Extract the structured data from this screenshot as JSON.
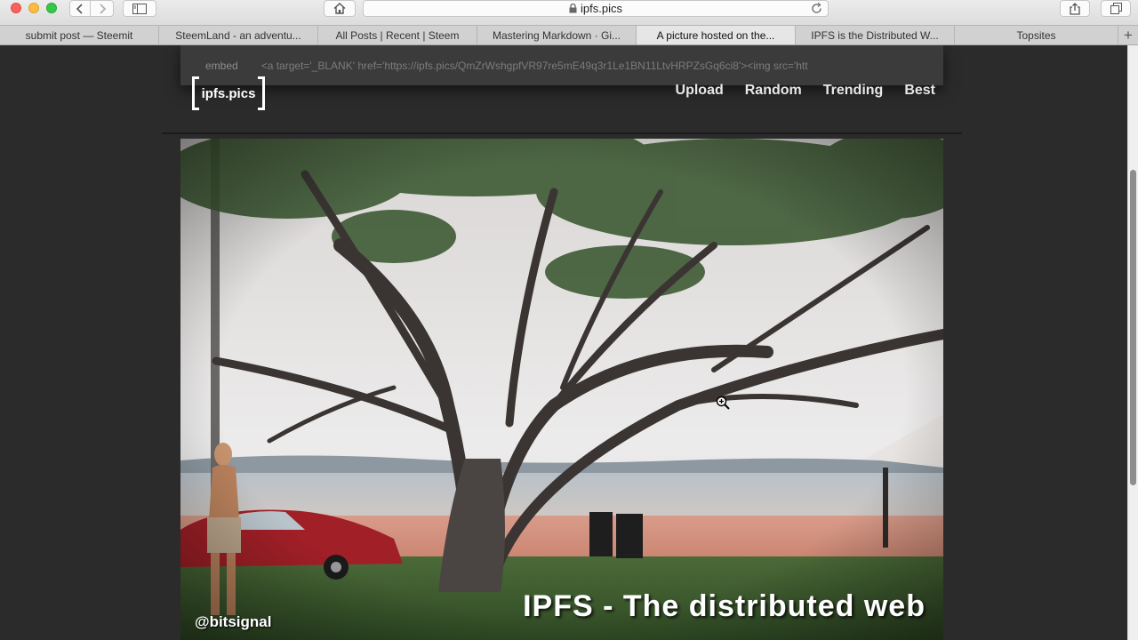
{
  "browser": {
    "url": "ipfs.pics",
    "tabs": [
      {
        "label": "submit post — Steemit"
      },
      {
        "label": "SteemLand - an adventu..."
      },
      {
        "label": "All Posts | Recent | Steem"
      },
      {
        "label": "Mastering Markdown · Gi..."
      },
      {
        "label": "A picture hosted on the..."
      },
      {
        "label": "IPFS is the Distributed W..."
      },
      {
        "label": "Topsites"
      }
    ],
    "active_tab": 4
  },
  "page": {
    "embed_label": "embed",
    "embed_code": "<a target='_BLANK' href='https://ipfs.pics/QmZrWshgpfVR97re5mE49q3r1Le1BN11LtvHRPZsGq6ci8'><img src='htt",
    "logo_text": "ipfs.pics",
    "nav": {
      "upload": "Upload",
      "random": "Random",
      "trending": "Trending",
      "best": "Best"
    },
    "photo": {
      "credit": "@bitsignal",
      "title": "IPFS - The distributed web"
    }
  }
}
